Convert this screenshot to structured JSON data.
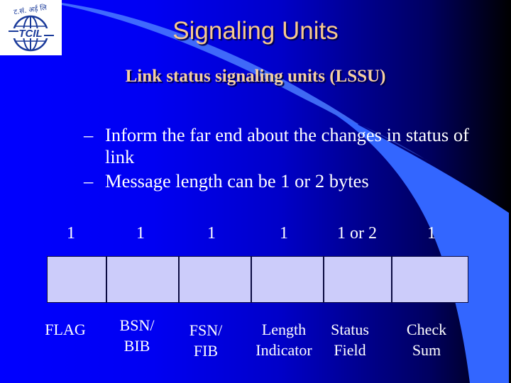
{
  "slide": {
    "title": "Signaling Units",
    "subtitle": "Link status signaling units (LSSU)",
    "logo": {
      "name": "tcil-logo",
      "text_top": "दू.सं. अर्ड़ लि",
      "text_main": "TCIL"
    },
    "bullets": [
      {
        "marker": "–",
        "line1": "Inform the far end about the changes in status of",
        "line2": "link"
      },
      {
        "marker": "–",
        "line1": "Message length can be 1 or 2 bytes",
        "line2": ""
      }
    ],
    "frame": {
      "fields": [
        {
          "size": "1",
          "name_line1": "FLAG",
          "name_line2": ""
        },
        {
          "size": "1",
          "name_line1": "BSN/",
          "name_line2": "BIB"
        },
        {
          "size": "1",
          "name_line1": "FSN/",
          "name_line2": "FIB"
        },
        {
          "size": "1",
          "name_line1": "Length",
          "name_line2": "Indicator"
        },
        {
          "size": "1 or 2",
          "name_line1": "Status",
          "name_line2": "Field"
        },
        {
          "size": "1",
          "name_line1": "Check",
          "name_line2": "Sum"
        }
      ]
    },
    "colors": {
      "title": "#f7c98f",
      "background_left": "#0000ff",
      "background_right": "#000000",
      "swoosh": "#3366ff",
      "cell_fill": "#ccccfa"
    }
  }
}
